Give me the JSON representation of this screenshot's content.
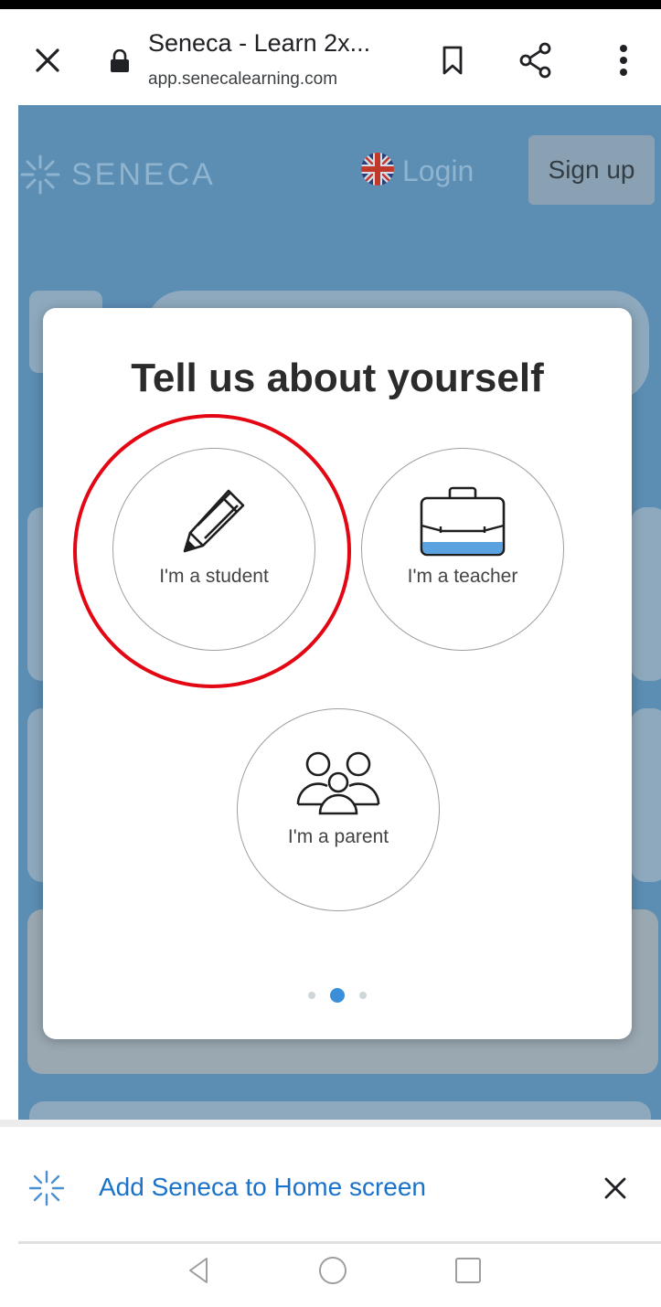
{
  "toolbar": {
    "title": "Seneca - Learn 2x...",
    "url": "app.senecalearning.com"
  },
  "page": {
    "logo_text": "SENECA",
    "login_label": "Login",
    "signup_label": "Sign up"
  },
  "modal": {
    "title": "Tell us about yourself",
    "roles": [
      {
        "label": "I'm a student",
        "icon": "pencil-icon"
      },
      {
        "label": "I'm a teacher",
        "icon": "briefcase-icon"
      },
      {
        "label": "I'm a parent",
        "icon": "family-icon"
      }
    ],
    "pagination": {
      "total": 3,
      "active": 2
    }
  },
  "add_to_home": {
    "label": "Add Seneca to Home screen"
  },
  "colors": {
    "page_bg": "#5c8db3",
    "accent_blue": "#3a8fd8",
    "highlight_red": "#e30613",
    "link_blue": "#1a73c8"
  }
}
